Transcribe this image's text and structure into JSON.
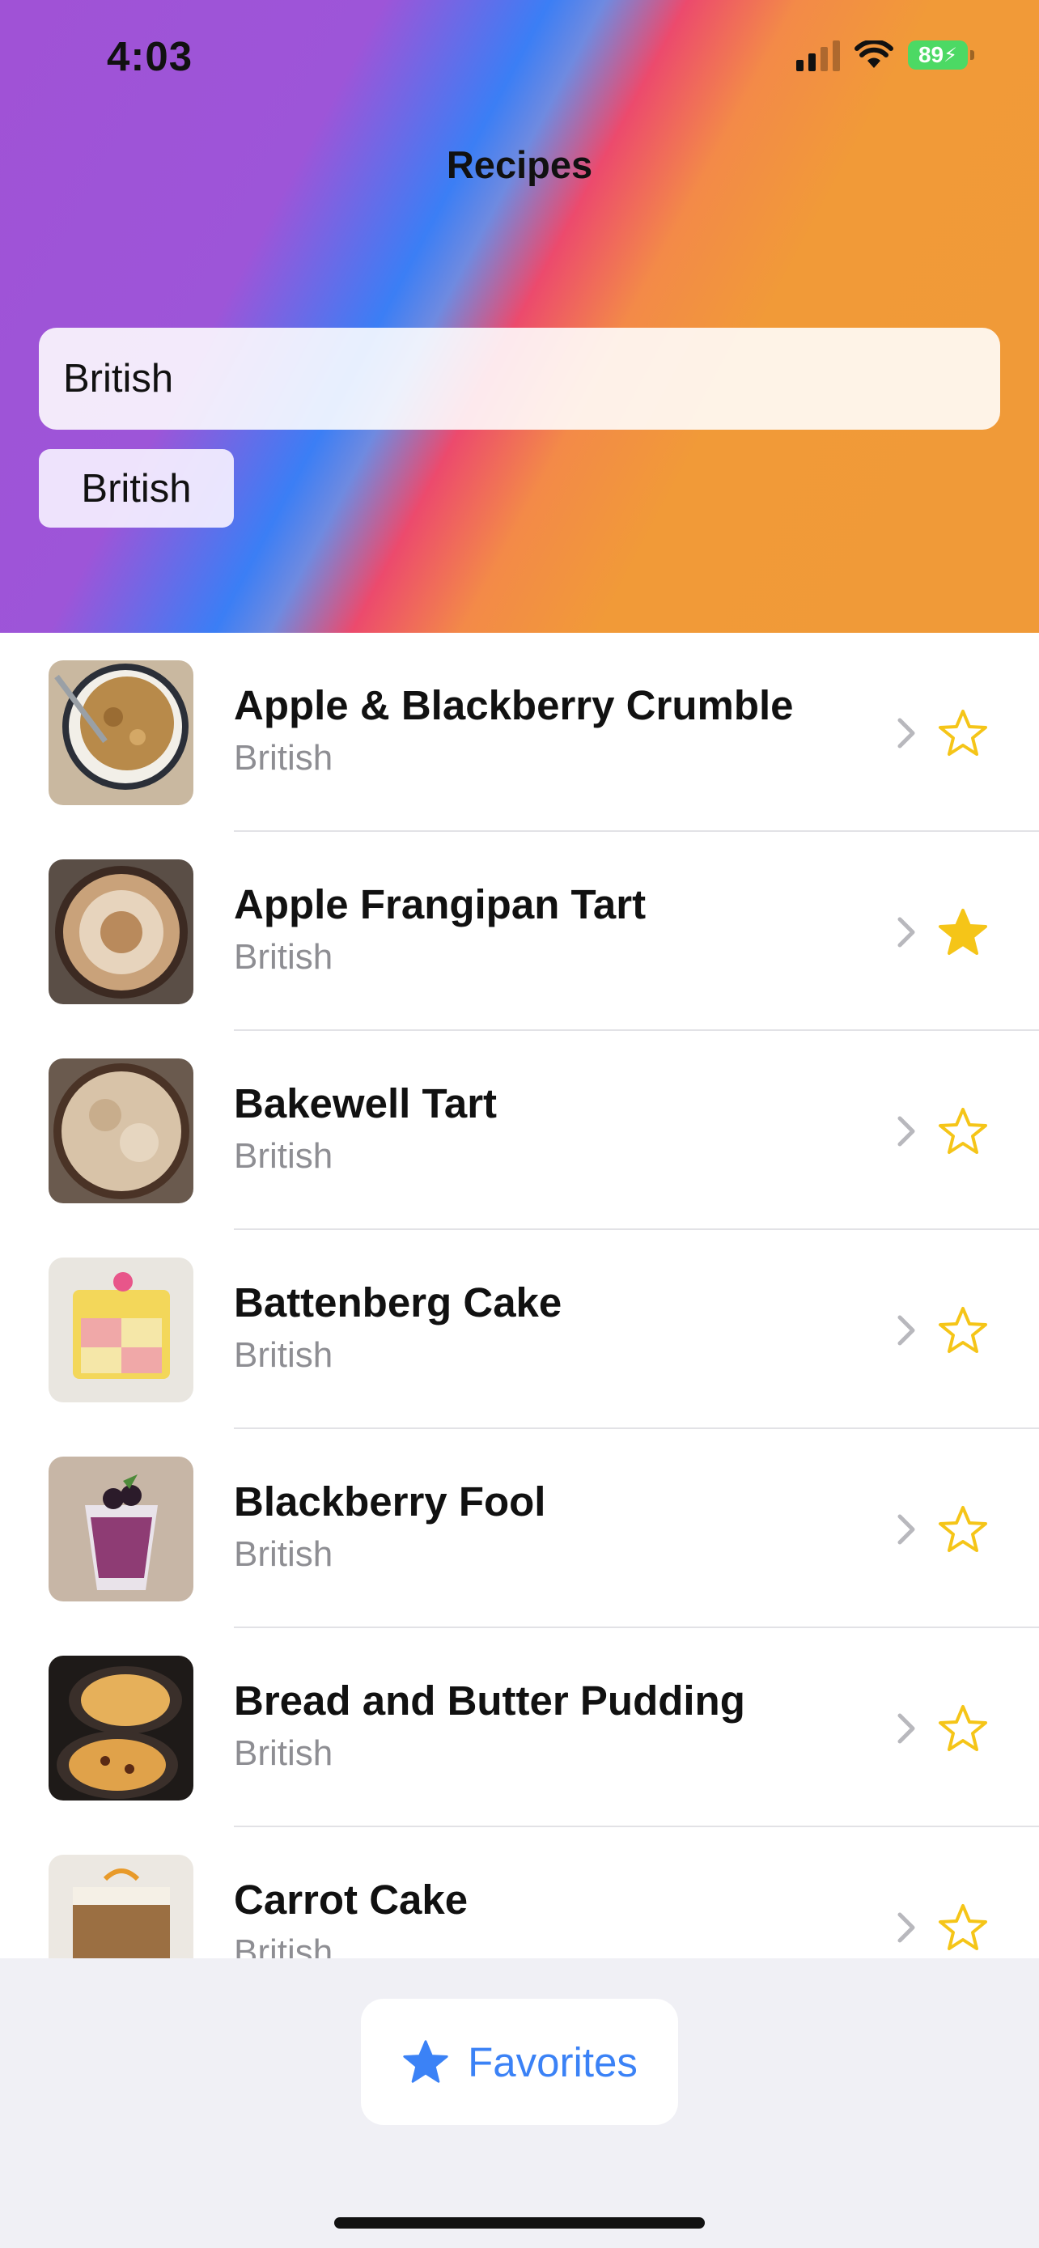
{
  "status_bar": {
    "time": "4:03",
    "battery": "89"
  },
  "nav": {
    "title": "Recipes"
  },
  "search": {
    "value": "British"
  },
  "filter_chip": {
    "label": "British"
  },
  "recipes": [
    {
      "name": "Apple & Blackberry Crumble",
      "category": "British",
      "favorite": false
    },
    {
      "name": "Apple Frangipan Tart",
      "category": "British",
      "favorite": true
    },
    {
      "name": "Bakewell Tart",
      "category": "British",
      "favorite": false
    },
    {
      "name": "Battenberg Cake",
      "category": "British",
      "favorite": false
    },
    {
      "name": "Blackberry Fool",
      "category": "British",
      "favorite": false
    },
    {
      "name": "Bread and Butter Pudding",
      "category": "British",
      "favorite": false
    },
    {
      "name": "Carrot Cake",
      "category": "British",
      "favorite": false
    }
  ],
  "toolbar": {
    "favorites_label": "Favorites"
  },
  "colors": {
    "accent": "#3b82f6",
    "star": "#f5c518",
    "secondary_text": "#8e8e93"
  }
}
